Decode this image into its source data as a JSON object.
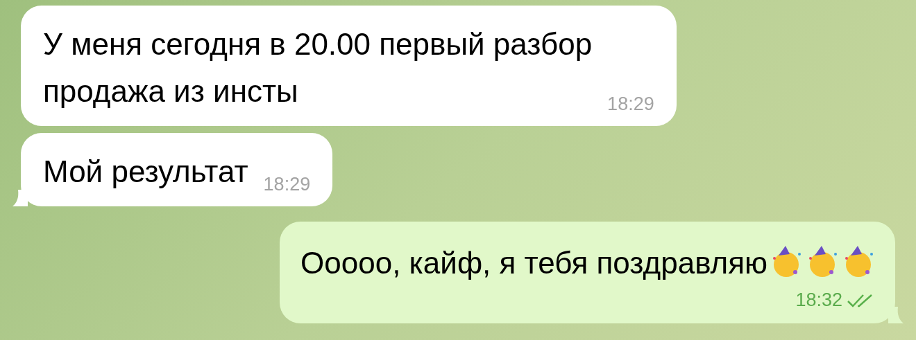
{
  "messages": [
    {
      "kind": "incoming",
      "text": "У меня сегодня в 20.00 первый разбор\nпродажа из инсты",
      "time": "18:29",
      "tail": false
    },
    {
      "kind": "incoming",
      "text": "Мой результат",
      "time": "18:29",
      "tail": true
    },
    {
      "kind": "outgoing",
      "text": "Ооооо, кайф, я тебя поздравляю",
      "time": "18:32",
      "read": true,
      "tail": true
    }
  ]
}
